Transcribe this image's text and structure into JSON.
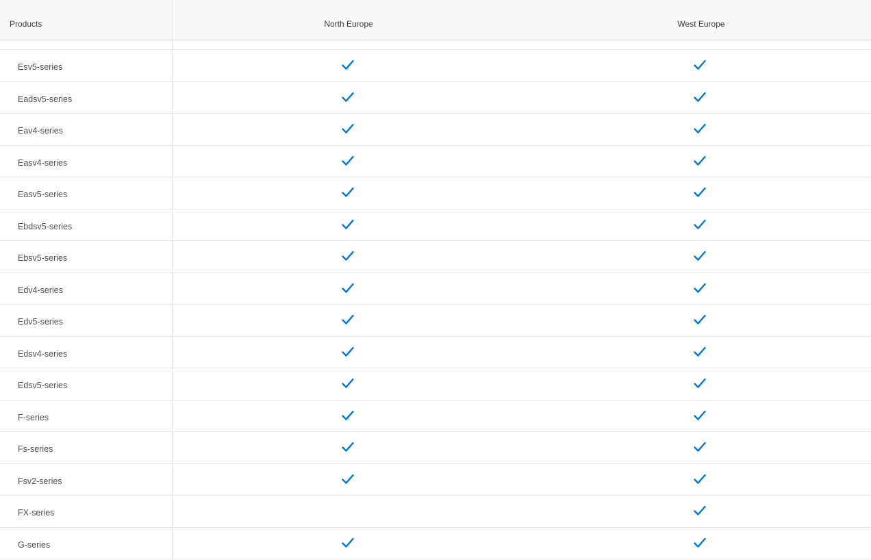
{
  "header": {
    "products_label": "Products",
    "columns": [
      "North Europe",
      "West Europe"
    ]
  },
  "colors": {
    "check": "#0078d4",
    "header_bg": "#f8f8f8",
    "row_text": "#505050",
    "divider": "#e6e6e6"
  },
  "icons": {
    "available": "checkmark-icon"
  },
  "rows": [
    {
      "name": "Esv5-series",
      "north_europe": true,
      "west_europe": true
    },
    {
      "name": "Eadsv5-series",
      "north_europe": true,
      "west_europe": true
    },
    {
      "name": "Eav4-series",
      "north_europe": true,
      "west_europe": true
    },
    {
      "name": "Easv4-series",
      "north_europe": true,
      "west_europe": true
    },
    {
      "name": "Easv5-series",
      "north_europe": true,
      "west_europe": true
    },
    {
      "name": "Ebdsv5-series",
      "north_europe": true,
      "west_europe": true
    },
    {
      "name": "Ebsv5-series",
      "north_europe": true,
      "west_europe": true
    },
    {
      "name": "Edv4-series",
      "north_europe": true,
      "west_europe": true
    },
    {
      "name": "Edv5-series",
      "north_europe": true,
      "west_europe": true
    },
    {
      "name": "Edsv4-series",
      "north_europe": true,
      "west_europe": true
    },
    {
      "name": "Edsv5-series",
      "north_europe": true,
      "west_europe": true
    },
    {
      "name": "F-series",
      "north_europe": true,
      "west_europe": true
    },
    {
      "name": "Fs-series",
      "north_europe": true,
      "west_europe": true
    },
    {
      "name": "Fsv2-series",
      "north_europe": true,
      "west_europe": true
    },
    {
      "name": "FX-series",
      "north_europe": false,
      "west_europe": true
    },
    {
      "name": "G-series",
      "north_europe": true,
      "west_europe": true
    }
  ]
}
